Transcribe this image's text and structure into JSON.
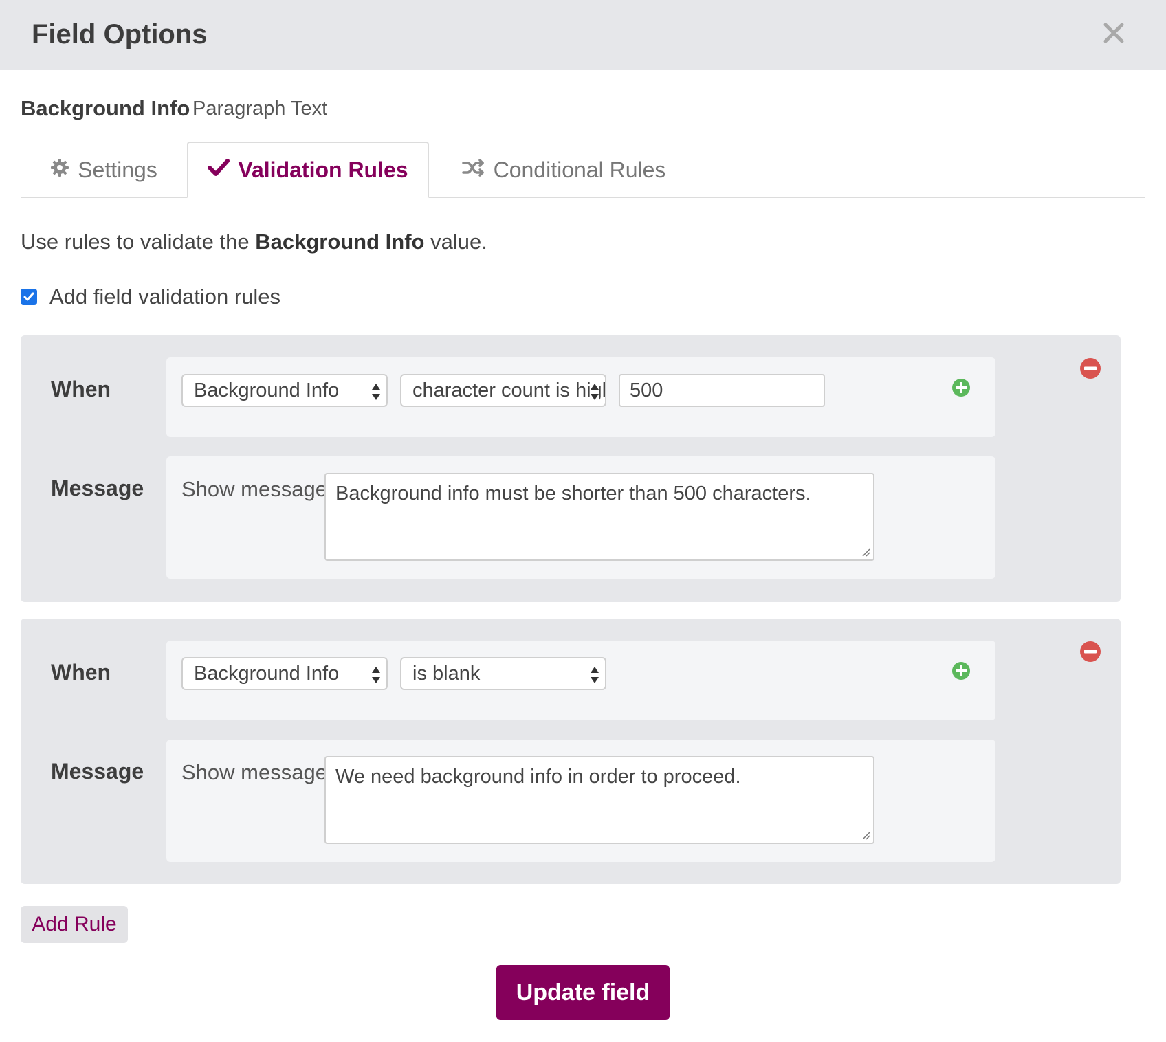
{
  "dialog": {
    "title": "Field Options",
    "close_icon": "close-icon"
  },
  "field": {
    "name": "Background Info",
    "type": "Paragraph Text"
  },
  "tabs": [
    {
      "label": "Settings",
      "icon": "gear-icon",
      "active": false
    },
    {
      "label": "Validation Rules",
      "icon": "checkmark-icon",
      "active": true
    },
    {
      "label": "Conditional Rules",
      "icon": "shuffle-icon",
      "active": false
    }
  ],
  "intro": {
    "prefix": "Use rules to validate the",
    "field": "Background Info",
    "suffix": "value."
  },
  "validation_toggle": {
    "label": "Add field validation rules",
    "checked": true
  },
  "rules": [
    {
      "when_label": "When",
      "field": "Background Info",
      "operator": "character count is higher than",
      "value": "500",
      "message_label": "Message",
      "show_message_label": "Show message",
      "message": "Background info must be shorter than 500 characters."
    },
    {
      "when_label": "When",
      "field": "Background Info",
      "operator": "is blank",
      "value": "",
      "message_label": "Message",
      "show_message_label": "Show message",
      "message": "We need background info in order to proceed."
    }
  ],
  "actions": {
    "add_rule": "Add Rule",
    "update": "Update field"
  },
  "colors": {
    "brand": "#85005b",
    "add": "#5cb85c",
    "remove": "#d9534f",
    "header_bg": "#e6e7ea"
  }
}
